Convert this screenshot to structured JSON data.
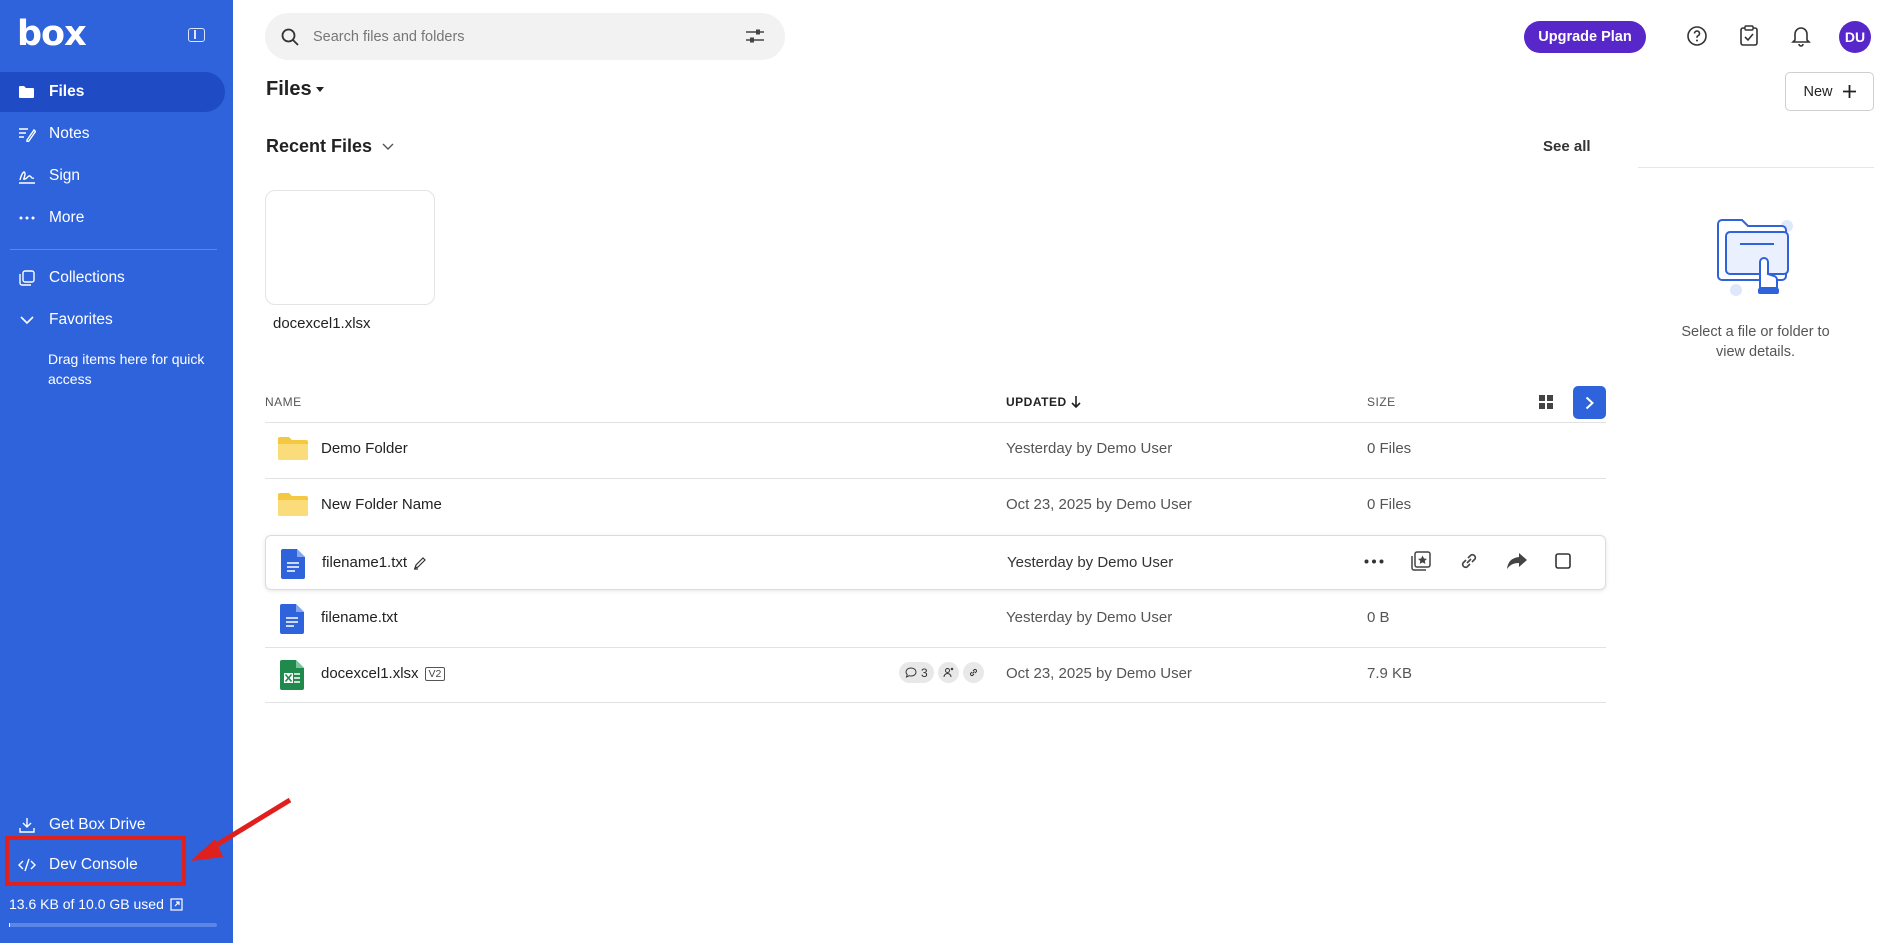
{
  "app": {
    "logo": "box"
  },
  "sidebar": {
    "items": [
      {
        "label": "Files",
        "icon": "folder-icon",
        "active": true
      },
      {
        "label": "Notes",
        "icon": "notes-icon"
      },
      {
        "label": "Sign",
        "icon": "sign-icon"
      },
      {
        "label": "More",
        "icon": "more-icon"
      },
      {
        "label": "Collections",
        "icon": "collections-icon"
      },
      {
        "label": "Favorites",
        "icon": "chevron-down-icon"
      }
    ],
    "favorites_hint": "Drag items here for quick access",
    "get_drive": "Get Box Drive",
    "dev_console": "Dev Console",
    "storage": "13.6 KB of 10.0 GB used",
    "storage_used_fraction": 1.4e-06
  },
  "header": {
    "search_placeholder": "Search files and folders",
    "upgrade_label": "Upgrade Plan",
    "avatar_initials": "DU",
    "new_label": "New"
  },
  "main": {
    "title": "Files",
    "recent_title": "Recent Files",
    "see_all": "See all",
    "recent_files": [
      {
        "name": "docexcel1.xlsx"
      }
    ],
    "columns": {
      "name": "NAME",
      "updated": "UPDATED",
      "size": "SIZE"
    },
    "rows": [
      {
        "type": "folder",
        "name": "Demo Folder",
        "updated": "Yesterday by Demo User",
        "size": "0 Files"
      },
      {
        "type": "folder",
        "name": "New Folder Name",
        "updated": "Oct 23, 2025 by Demo User",
        "size": "0 Files"
      },
      {
        "type": "doc",
        "name": "filename1.txt",
        "updated": "Yesterday by Demo User",
        "size": ""
      },
      {
        "type": "doc",
        "name": "filename.txt",
        "updated": "Yesterday by Demo User",
        "size": "0 B"
      },
      {
        "type": "xlsx",
        "name": "docexcel1.xlsx",
        "version": "V2",
        "comments": "3",
        "updated": "Oct 23, 2025 by Demo User",
        "size": "7.9 KB"
      }
    ]
  },
  "details": {
    "empty_text": "Select a file or folder to view details."
  },
  "colors": {
    "sidebar": "#2e63db",
    "accent": "#5727c9",
    "annotation": "#e0201d"
  }
}
